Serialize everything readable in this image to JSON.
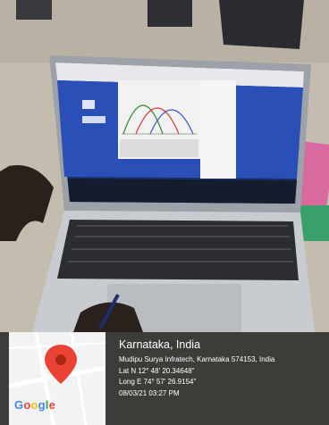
{
  "geotag": {
    "place": "Karnataka, India",
    "address": "Mudipu Surya Infratech, Karnataka 574153, India",
    "latitude": "Lat N 12° 48' 20.34648\"",
    "longitude": "Long E 74° 57' 26.9154\"",
    "datetime": "08/03/21 03:27 PM"
  },
  "map": {
    "logo_letters": [
      "G",
      "o",
      "o",
      "g",
      "l",
      "e"
    ],
    "pin_color": "#ea4335"
  },
  "scene": {
    "description_icons": [
      "laptop",
      "gaussian-curve-plot-window",
      "keyboard",
      "touchpad",
      "hand",
      "pen"
    ],
    "curve_colors": [
      "#2a8a2a",
      "#d03a3a",
      "#3a56c8"
    ]
  }
}
